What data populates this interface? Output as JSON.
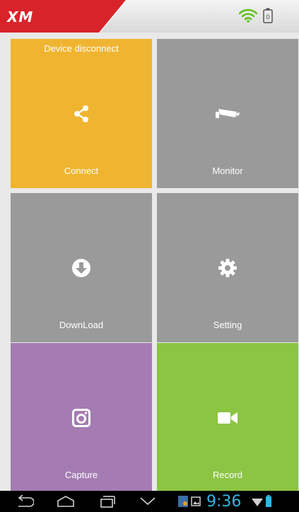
{
  "header": {
    "logo": "XM",
    "brand_color": "#d8232a",
    "wifi_color": "#5ec21c"
  },
  "tiles": {
    "connect": {
      "status": "Device disconnect",
      "label": "Connect",
      "color": "#efb531",
      "icon": "share-icon"
    },
    "monitor": {
      "label": "Monitor",
      "color": "#9a9a9a",
      "icon": "cctv-camera-icon"
    },
    "download": {
      "label": "DownLoad",
      "color": "#9a9a9a",
      "icon": "download-icon"
    },
    "setting": {
      "label": "Setting",
      "color": "#9a9a9a",
      "icon": "gear-icon"
    },
    "capture": {
      "label": "Capture",
      "color": "#a47cb3",
      "icon": "camera-icon"
    },
    "record": {
      "label": "Record",
      "color": "#8cc443",
      "icon": "video-camera-icon"
    }
  },
  "system_bar": {
    "time": "9:36",
    "time_color": "#33b5e5",
    "nav_buttons": [
      "back-icon",
      "home-icon",
      "recents-icon",
      "collapse-chevron-icon"
    ]
  }
}
